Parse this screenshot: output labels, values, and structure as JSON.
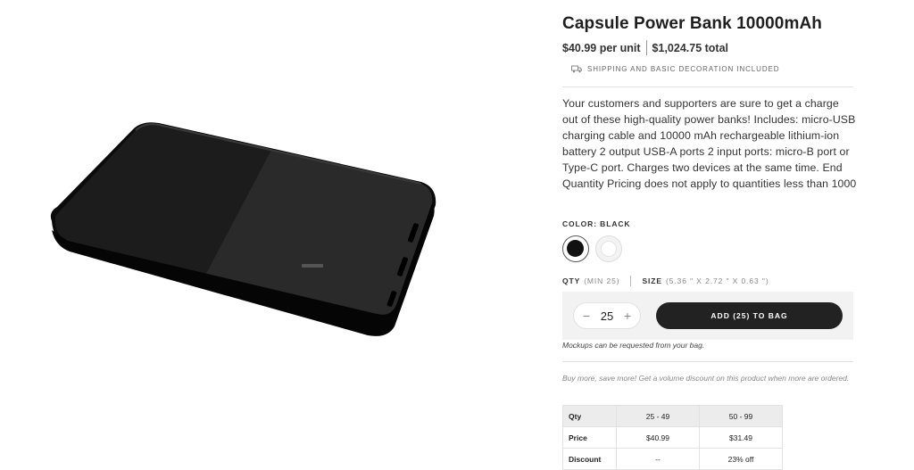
{
  "product": {
    "title": "Capsule Power Bank 10000mAh",
    "price_per_unit": "$40.99 per unit",
    "price_total": "$1,024.75 total",
    "shipping_note": "Shipping and basic decoration included",
    "description": "Your customers and supporters are sure to get a charge out of these high-quality power banks! Includes: micro-USB charging cable and 10000 mAh rechargeable lithium-ion battery 2 output USB-A ports 2 input ports: micro-B port or Type-C port. Charges two devices at the same time. End Quantity Pricing does not apply to quantities less than 1000"
  },
  "color": {
    "label": "COLOR: BLACK",
    "options": [
      {
        "name": "black",
        "hex": "#111111",
        "selected": true
      },
      {
        "name": "white",
        "hex": "#ffffff",
        "selected": false
      }
    ]
  },
  "qty": {
    "label": "QTY",
    "min_note": "(MIN 25)",
    "size_label": "SIZE",
    "size_value": "(5.36 \" X 2.72 \" X 0.63 \")",
    "value": "25",
    "minus": "−",
    "plus": "+"
  },
  "cart": {
    "add_button": "ADD (25) TO BAG",
    "mockup_note": "Mockups can be requested from your bag."
  },
  "volume": {
    "note": "Buy more, save more! Get a volume discount on this product when more are ordered.",
    "headers": [
      "Qty",
      "25 - 49",
      "50 - 99"
    ],
    "rows": [
      [
        "Price",
        "$40.99",
        "$31.49"
      ],
      [
        "Discount",
        "--",
        "23% off"
      ]
    ]
  },
  "colors": {
    "button_bg": "#222222",
    "cart_box_bg": "#f2f2f2"
  }
}
